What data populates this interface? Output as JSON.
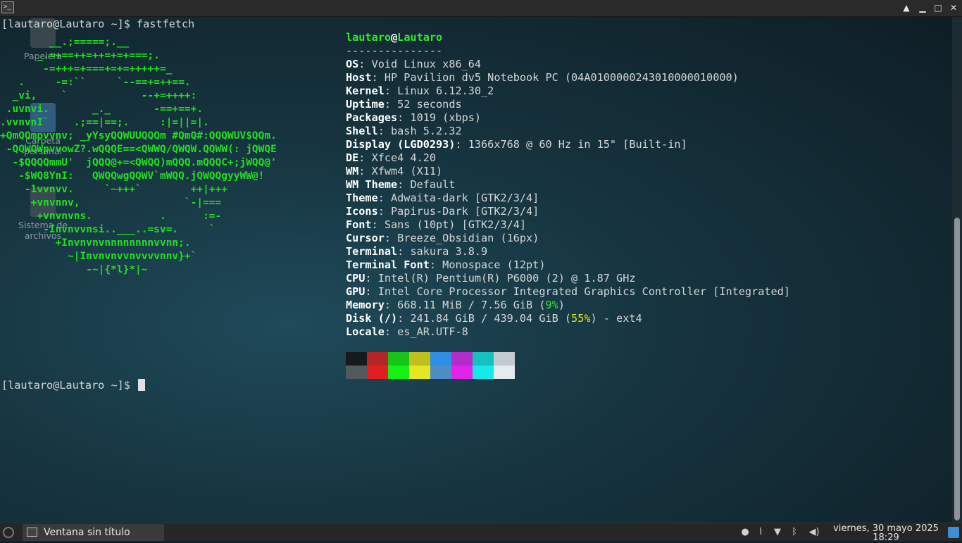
{
  "window": {
    "icon_text": ">_",
    "buttons": {
      "up": "▲",
      "minimize": "▁",
      "maximize": "□",
      "close": "✕"
    }
  },
  "desktop_icons": [
    {
      "label": "Papelera"
    },
    {
      "label": "Carpeta personal"
    },
    {
      "label": "Sistema de archivos"
    }
  ],
  "terminal": {
    "prompt1": "[lautaro@Lautaro ~]$ fastfetch",
    "prompt2": "[lautaro@Lautaro ~]$ ",
    "ascii_logo": "        __.;=====;.__\n      _.=+==++=++=+=+===;.\n       -=+++=+===+=+=+++++=_\n   .     -=:``     `--==+=++==.\n  _vi,    `            --+=++++:\n .uvnvi.       _._       -==+==+.\n.vvnvnI`    .;==|==;.     :|=||=|.\n+QmQQmpvvnv; _yYsyQQWUUQQQm #QmQ#:QQQWUV$QQm.\n -QQWQWpvvowZ?.wQQQE==<QWWQ/QWQW.QQWW(: jQWQE\n  -$QQQQmmU'  jQQQ@+=<QWQQ)mQQQ.mQQQC+;jWQQ@'\n   -$WQ8YnI:   QWQQwgQQWV`mWQQ.jQWQQgyyWW@!\n    -1vvnvv.     `~+++`        ++|+++\n     +vnvnnv,                 `-|===\n      +vnvnvns.           .      :=-\n       -Invnvvnsi..___..=sv=.     `\n         +Invnvnvnnnnnnnnvvnn;.\n           ~|Invnvnvvnvvvvnnv}+`\n              -~|{*l}*|~",
    "user": "lautaro",
    "at": "@",
    "host": "Lautaro",
    "separator": "---------------",
    "info": [
      {
        "key": "OS",
        "value": "Void Linux x86_64"
      },
      {
        "key": "Host",
        "value": "HP Pavilion dv5 Notebook PC (04A0100000243010000010000)"
      },
      {
        "key": "Kernel",
        "value": "Linux 6.12.30_2"
      },
      {
        "key": "Uptime",
        "value": "52 seconds"
      },
      {
        "key": "Packages",
        "value": "1019 (xbps)"
      },
      {
        "key": "Shell",
        "value": "bash 5.2.32"
      },
      {
        "key": "Display (LGD0293)",
        "value": "1366x768 @ 60 Hz in 15\" [Built-in]"
      },
      {
        "key": "DE",
        "value": "Xfce4 4.20"
      },
      {
        "key": "WM",
        "value": "Xfwm4 (X11)"
      },
      {
        "key": "WM Theme",
        "value": "Default"
      },
      {
        "key": "Theme",
        "value": "Adwaita-dark [GTK2/3/4]"
      },
      {
        "key": "Icons",
        "value": "Papirus-Dark [GTK2/3/4]"
      },
      {
        "key": "Font",
        "value": "Sans (10pt) [GTK2/3/4]"
      },
      {
        "key": "Cursor",
        "value": "Breeze_Obsidian (16px)"
      },
      {
        "key": "Terminal",
        "value": "sakura 3.8.9"
      },
      {
        "key": "Terminal Font",
        "value": "Monospace (12pt)"
      },
      {
        "key": "CPU",
        "value": "Intel(R) Pentium(R) P6000 (2) @ 1.87 GHz"
      },
      {
        "key": "GPU",
        "value": "Intel Core Processor Integrated Graphics Controller [Integrated]"
      }
    ],
    "memory": {
      "key": "Memory",
      "value_pre": "668.11 MiB / 7.56 GiB (",
      "pct": "9%",
      "value_post": ")"
    },
    "disk": {
      "key": "Disk (/)",
      "value_pre": "241.84 GiB / 439.04 GiB (",
      "pct": "55%",
      "value_post": ") - ext4"
    },
    "locale": {
      "key": "Locale",
      "value": "es_AR.UTF-8"
    },
    "palette_top": [
      "#171a1c",
      "#b52525",
      "#17c417",
      "#bfbf20",
      "#2d8ee6",
      "#b32bc9",
      "#17bfbf",
      "#c2cbcf"
    ],
    "palette_bottom": [
      "#535a5e",
      "#e01f1f",
      "#17f017",
      "#e6e622",
      "#4a8ec2",
      "#e124e8",
      "#17e8e8",
      "#e5ecef"
    ]
  },
  "taskbar": {
    "task_label": "Ventana sin título",
    "clock_date": "viernes, 30 mayo 2025",
    "clock_time": "18:29"
  }
}
